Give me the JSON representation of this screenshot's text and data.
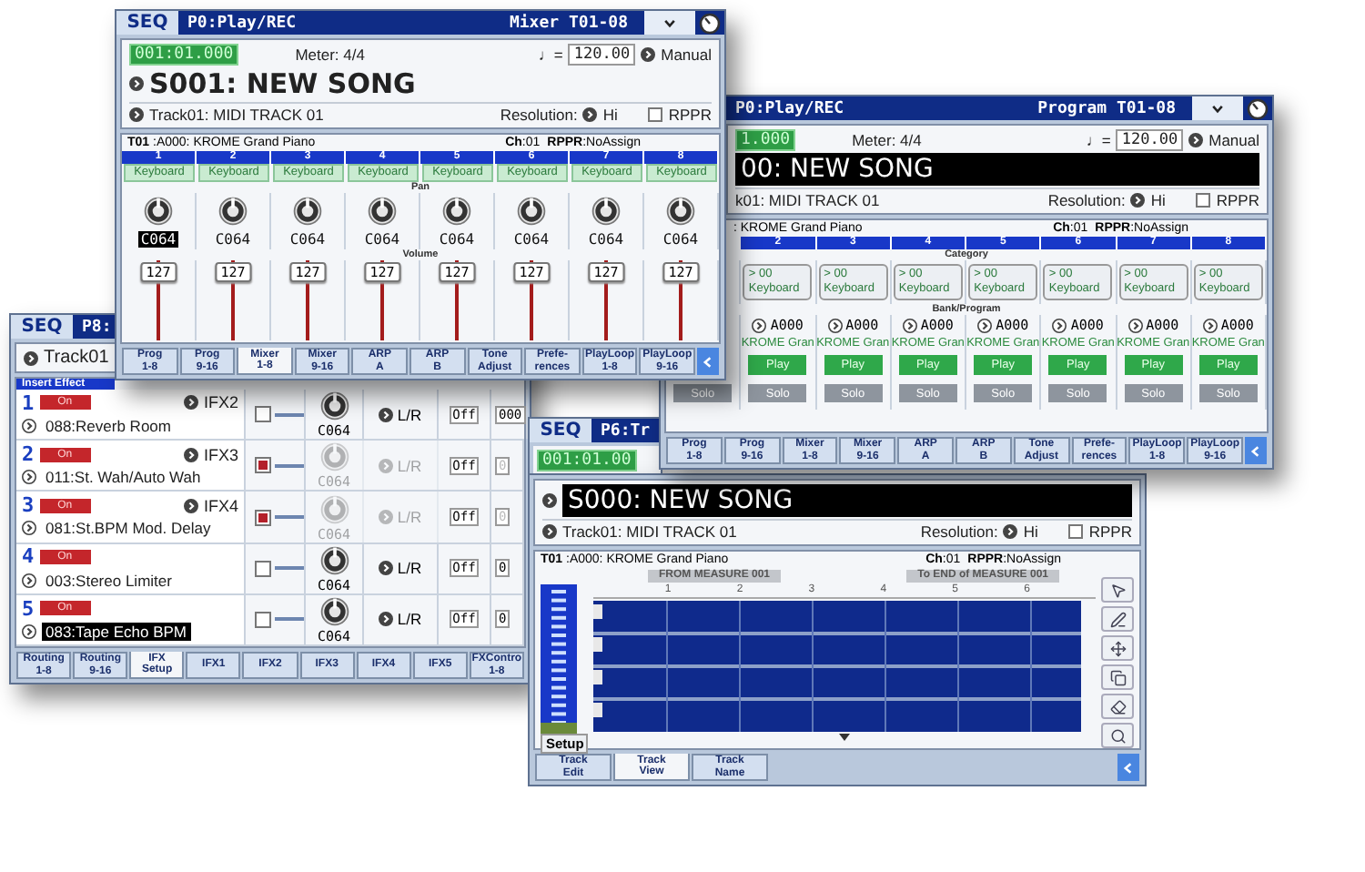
{
  "mixer_window": {
    "mode": "SEQ",
    "page": "P0:Play/REC",
    "view": "Mixer T01-08",
    "header": {
      "location": "001:01.000",
      "meter": "Meter:  4/4",
      "tempo_mark": "♩=",
      "tempo": "120.00",
      "tempo_mode": "Manual",
      "song": "S001: NEW SONG",
      "track": "Track01: MIDI TRACK 01",
      "resolution_label": "Resolution:",
      "resolution": "Hi",
      "rppr": {
        "label": "RPPR",
        "checked": false
      }
    },
    "info": {
      "program": "**T01** :A000: KROME Grand Piano",
      "channel": "**Ch**:01",
      "rppr_assign": "**RPPR**:NoAssign"
    },
    "pan_label": "Pan",
    "volume_label": "Volume",
    "channels": [
      {
        "number": "1",
        "category": "Keyboard",
        "pan": "C064",
        "selected": true,
        "volume": "127",
        "level": 1
      },
      {
        "number": "2",
        "category": "Keyboard",
        "pan": "C064",
        "selected": false,
        "volume": "127",
        "level": 1
      },
      {
        "number": "3",
        "category": "Keyboard",
        "pan": "C064",
        "selected": false,
        "volume": "127",
        "level": 1
      },
      {
        "number": "4",
        "category": "Keyboard",
        "pan": "C064",
        "selected": false,
        "volume": "127",
        "level": 1
      },
      {
        "number": "5",
        "category": "Keyboard",
        "pan": "C064",
        "selected": false,
        "volume": "127",
        "level": 1
      },
      {
        "number": "6",
        "category": "Keyboard",
        "pan": "C064",
        "selected": false,
        "volume": "127",
        "level": 1
      },
      {
        "number": "7",
        "category": "Keyboard",
        "pan": "C064",
        "selected": false,
        "volume": "127",
        "level": 1
      },
      {
        "number": "8",
        "category": "Keyboard",
        "pan": "C064",
        "selected": false,
        "volume": "127",
        "level": 1
      }
    ],
    "tabs": [
      {
        "label": "Prog\n1-8",
        "selected": false
      },
      {
        "label": "Prog\n9-16",
        "selected": false
      },
      {
        "label": "Mixer\n1-8",
        "selected": true
      },
      {
        "label": "Mixer\n9-16",
        "selected": false
      },
      {
        "label": "ARP\nA",
        "selected": false
      },
      {
        "label": "ARP\nB",
        "selected": false
      },
      {
        "label": "Tone\nAdjust",
        "selected": false
      },
      {
        "label": "Prefe-\nrences",
        "selected": false
      },
      {
        "label": "PlayLoop\n1-8",
        "selected": false
      },
      {
        "label": "PlayLoop\n9-16",
        "selected": false
      }
    ]
  },
  "program_window": {
    "page": "P0:Play/REC",
    "view": "Program T01-08",
    "header": {
      "location": "1.000",
      "meter": "Meter:  4/4",
      "tempo_mark": "♩=",
      "tempo": "120.00",
      "tempo_mode": "Manual",
      "song": "00: NEW SONG",
      "track": "k01: MIDI TRACK 01",
      "resolution_label": "Resolution:",
      "resolution": "Hi",
      "rppr": {
        "label": "RPPR",
        "checked": false
      }
    },
    "info": {
      "program": ": KROME Grand Piano",
      "channel": "**Ch**:01",
      "rppr_assign": "**RPPR**:NoAssign"
    },
    "category_label": "Category",
    "bank_label": "Bank/Program",
    "channels": [
      {
        "solo": "Solo",
        "solo_on": false
      },
      {
        "number": "2",
        "category_number": "> 00",
        "category": "Keyboard",
        "bank": "A000",
        "program": "KROME Gran",
        "play": "Play",
        "solo": "Solo",
        "solo_on": false
      },
      {
        "number": "3",
        "category_number": "> 00",
        "category": "Keyboard",
        "bank": "A000",
        "program": "KROME Gran",
        "play": "Play",
        "solo": "Solo",
        "solo_on": false
      },
      {
        "number": "4",
        "category_number": "> 00",
        "category": "Keyboard",
        "bank": "A000",
        "program": "KROME Gran",
        "play": "Play",
        "solo": "Solo",
        "solo_on": false
      },
      {
        "number": "5",
        "category_number": "> 00",
        "category": "Keyboard",
        "bank": "A000",
        "program": "KROME Gran",
        "play": "Play",
        "solo": "Solo",
        "solo_on": false
      },
      {
        "number": "6",
        "category_number": "> 00",
        "category": "Keyboard",
        "bank": "A000",
        "program": "KROME Gran",
        "play": "Play",
        "solo": "Solo",
        "solo_on": false
      },
      {
        "number": "7",
        "category_number": "> 00",
        "category": "Keyboard",
        "bank": "A000",
        "program": "KROME Gran",
        "play": "Play",
        "solo": "Solo",
        "solo_on": false
      },
      {
        "number": "8",
        "category_number": "> 00",
        "category": "Keyboard",
        "bank": "A000",
        "program": "KROME Gran",
        "play": "Play",
        "solo": "Solo",
        "solo_on": false
      }
    ],
    "tabs": [
      {
        "label": "Prog\n1-8",
        "selected": false
      },
      {
        "label": "Prog\n9-16",
        "selected": false
      },
      {
        "label": "Mixer\n1-8",
        "selected": false
      },
      {
        "label": "Mixer\n9-16",
        "selected": false
      },
      {
        "label": "ARP\nA",
        "selected": false
      },
      {
        "label": "ARP\nB",
        "selected": false
      },
      {
        "label": "Tone\nAdjust",
        "selected": false
      },
      {
        "label": "Prefe-\nrences",
        "selected": false
      },
      {
        "label": "PlayLoop\n1-8",
        "selected": false
      },
      {
        "label": "PlayLoop\n9-16",
        "selected": false
      }
    ]
  },
  "ifx_window": {
    "mode": "SEQ",
    "page": "P8:",
    "track": "Track01",
    "section": "Insert Effect",
    "slots": [
      {
        "number": "1",
        "on": "On",
        "chain": "IFX2",
        "effect": "088:Reverb Room",
        "selected": false,
        "routed": false,
        "active": true,
        "pan": "C064",
        "output": "L/R",
        "bus": "Off",
        "send": "000"
      },
      {
        "number": "2",
        "on": "On",
        "chain": "IFX3",
        "effect": "011:St. Wah/Auto Wah",
        "selected": false,
        "routed": true,
        "active": false,
        "pan": "C064",
        "output": "L/R",
        "bus": "Off",
        "send": "0"
      },
      {
        "number": "3",
        "on": "On",
        "chain": "IFX4",
        "effect": "081:St.BPM Mod. Delay",
        "selected": false,
        "routed": true,
        "active": false,
        "pan": "C064",
        "output": "L/R",
        "bus": "Off",
        "send": "0"
      },
      {
        "number": "4",
        "on": "On",
        "effect": "003:Stereo Limiter",
        "selected": false,
        "routed": false,
        "active": true,
        "pan": "C064",
        "output": "L/R",
        "bus": "Off",
        "send": "0"
      },
      {
        "number": "5",
        "on": "On",
        "effect": "083:Tape Echo BPM",
        "selected": true,
        "routed": false,
        "active": true,
        "pan": "C064",
        "output": "L/R",
        "bus": "Off",
        "send": "0"
      }
    ],
    "tabs": [
      {
        "label": "Routing\n1-8",
        "selected": false
      },
      {
        "label": "Routing\n9-16",
        "selected": false
      },
      {
        "label": "IFX\nSetup",
        "selected": true
      },
      {
        "label": "IFX1",
        "selected": false
      },
      {
        "label": "IFX2",
        "selected": false
      },
      {
        "label": "IFX3",
        "selected": false
      },
      {
        "label": "IFX4",
        "selected": false
      },
      {
        "label": "IFX5",
        "selected": false
      },
      {
        "label": "FXContro\n1-8",
        "selected": false
      }
    ]
  },
  "track_view_window": {
    "mode": "SEQ",
    "page": "P6:Tr",
    "header": {
      "location": "001:01.00",
      "song": "S000: NEW SONG",
      "track": "Track01: MIDI TRACK 01",
      "resolution_label": "Resolution:",
      "resolution": "Hi",
      "rppr": {
        "label": "RPPR",
        "checked": false
      }
    },
    "info": {
      "program": "**T01** :A000: KROME Grand Piano",
      "channel": "**Ch**:01",
      "rppr_assign": "**RPPR**:NoAssign"
    },
    "from": "FROM MEASURE 001",
    "to": "To END of MEASURE 001",
    "measures": [
      "1",
      "2",
      "3",
      "4",
      "5",
      "6"
    ],
    "setup": "Setup",
    "tabs": [
      {
        "label": "Track\nEdit",
        "selected": false
      },
      {
        "label": "Track\nView",
        "selected": true
      },
      {
        "label": "Track\nName",
        "selected": false
      }
    ]
  }
}
